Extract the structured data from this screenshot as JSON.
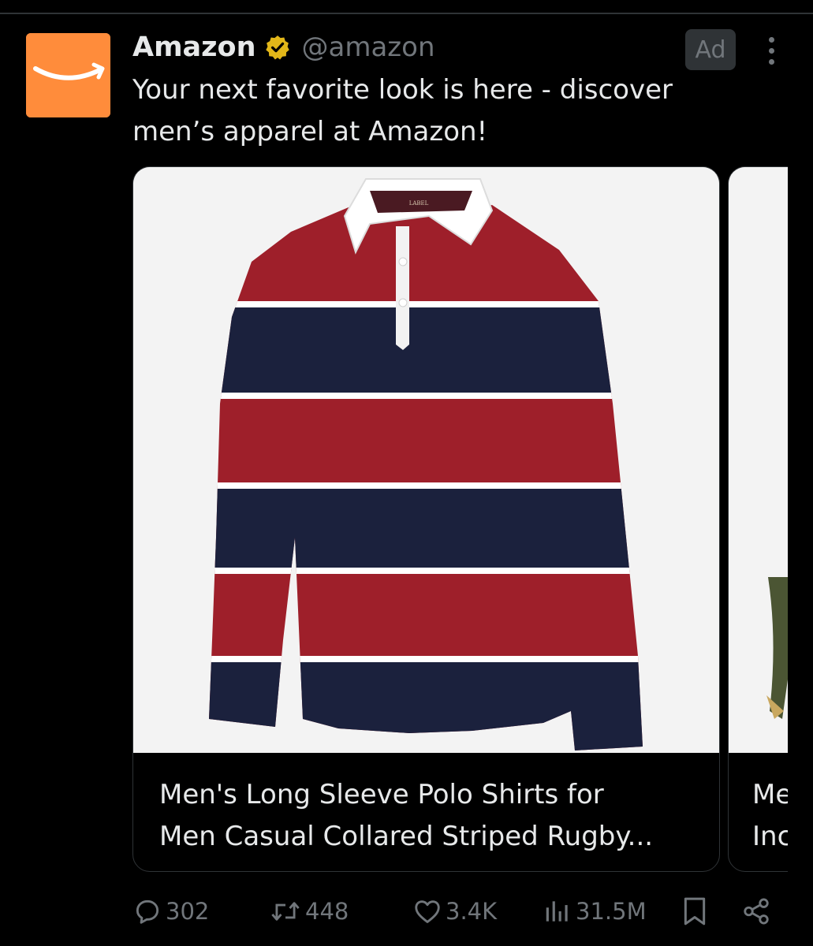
{
  "colors": {
    "background": "#000000",
    "text_primary": "#e7e9ea",
    "text_secondary": "#71767b",
    "avatar_bg": "#ff8c3b",
    "verified_badge": "#e2b719",
    "shirt_red": "#9e1f2a",
    "shirt_navy": "#1b213d"
  },
  "post": {
    "author": {
      "display_name": "Amazon",
      "handle": "@amazon",
      "verified": true,
      "avatar_icon": "amazon-smile-logo"
    },
    "ad_label": "Ad",
    "text_lines": [
      "Your next favorite look is here - discover",
      "men’s apparel at Amazon!"
    ]
  },
  "carousel": {
    "cards": [
      {
        "image": "striped-rugby-polo-shirt",
        "title_lines": [
          "Men's Long Sleeve Polo Shirts for",
          "Men Casual Collared Striped Rugby..."
        ]
      },
      {
        "image": "green-jacket-partial",
        "title_lines": [
          "Me",
          "Inc"
        ]
      }
    ]
  },
  "actions": {
    "replies": "302",
    "reposts": "448",
    "likes": "3.4K",
    "views": "31.5M",
    "icons": [
      "reply-icon",
      "repost-icon",
      "like-icon",
      "views-icon",
      "bookmark-icon",
      "share-icon"
    ]
  }
}
